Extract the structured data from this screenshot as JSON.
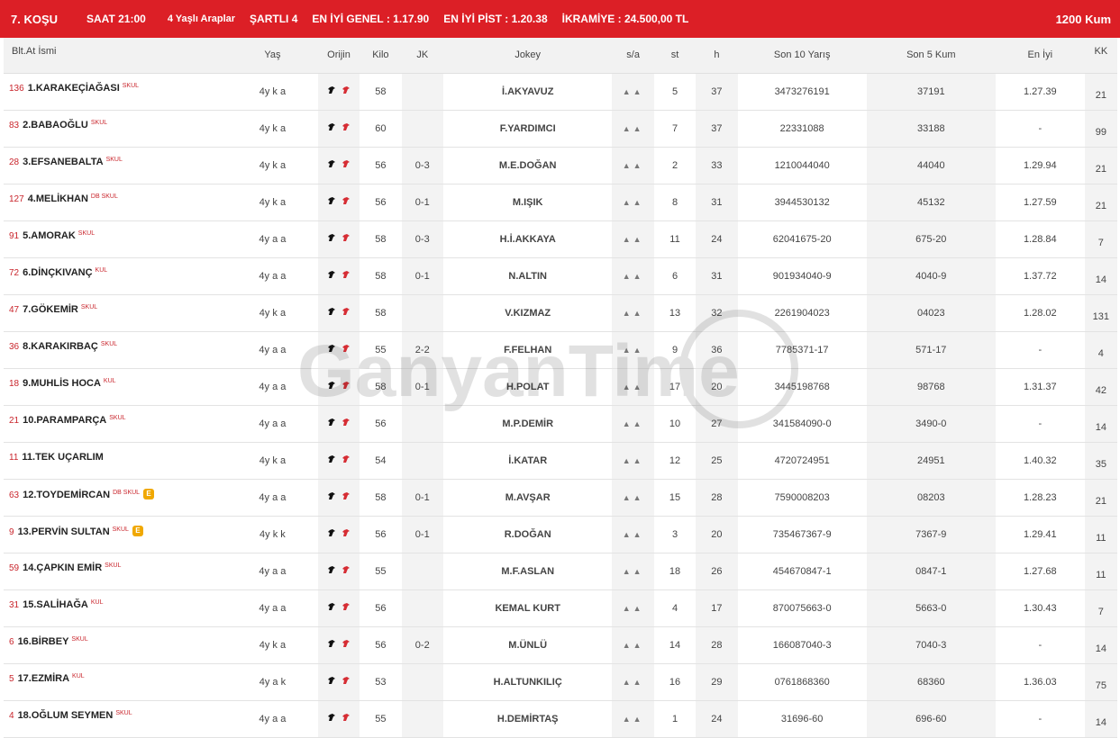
{
  "header": {
    "race": "7. KOŞU",
    "time": "SAAT 21:00",
    "class": "4 Yaşlı Araplar",
    "condition": "ŞARTLI 4",
    "best_overall": "EN İYİ GENEL : 1.17.90",
    "best_track": "EN İYİ PİST : 1.20.38",
    "prize": "İKRAMİYE : 24.500,00 TL",
    "distance": "1200 Kum"
  },
  "columns": {
    "name": "Blt.At İsmi",
    "age": "Yaş",
    "origin": "Orijin",
    "weight": "Kilo",
    "jk": "JK",
    "jockey": "Jokey",
    "sa": "s/a",
    "st": "st",
    "h": "h",
    "last10": "Son 10 Yarış",
    "last5": "Son 5 Kum",
    "best": "En İyi",
    "kk": "KK"
  },
  "watermark": "GanyanTime",
  "colors": {
    "accent": "#dc1f26",
    "equipment": "#c9252c",
    "badge": "#f0a800"
  },
  "rows": [
    {
      "blt": "136",
      "name": "1.KARAKEÇİAĞASI",
      "eq": "SKUL",
      "badge": "",
      "age": "4y k a",
      "weight": "58",
      "jk": "",
      "jockey": "İ.AKYAVUZ",
      "st": "5",
      "h": "37",
      "last10": "3473276191",
      "last5": "37191",
      "best": "1.27.39",
      "kk": "21"
    },
    {
      "blt": "83",
      "name": "2.BABAOĞLU",
      "eq": "SKUL",
      "badge": "",
      "age": "4y k a",
      "weight": "60",
      "jk": "",
      "jockey": "F.YARDIMCI",
      "st": "7",
      "h": "37",
      "last10": "22331088",
      "last5": "33188",
      "best": "-",
      "kk": "99"
    },
    {
      "blt": "28",
      "name": "3.EFSANEBALTA",
      "eq": "SKUL",
      "badge": "",
      "age": "4y k a",
      "weight": "56",
      "jk": "0-3",
      "jockey": "M.E.DOĞAN",
      "st": "2",
      "h": "33",
      "last10": "1210044040",
      "last5": "44040",
      "best": "1.29.94",
      "kk": "21"
    },
    {
      "blt": "127",
      "name": "4.MELİKHAN",
      "eq": "DB SKUL",
      "badge": "",
      "age": "4y k a",
      "weight": "56",
      "jk": "0-1",
      "jockey": "M.IŞIK",
      "st": "8",
      "h": "31",
      "last10": "3944530132",
      "last5": "45132",
      "best": "1.27.59",
      "kk": "21"
    },
    {
      "blt": "91",
      "name": "5.AMORAK",
      "eq": "SKUL",
      "badge": "",
      "age": "4y a a",
      "weight": "58",
      "jk": "0-3",
      "jockey": "H.İ.AKKAYA",
      "st": "11",
      "h": "24",
      "last10": "62041675-20",
      "last5": "675-20",
      "best": "1.28.84",
      "kk": "7"
    },
    {
      "blt": "72",
      "name": "6.DİNÇKIVANÇ",
      "eq": "KUL",
      "badge": "",
      "age": "4y a a",
      "weight": "58",
      "jk": "0-1",
      "jockey": "N.ALTIN",
      "st": "6",
      "h": "31",
      "last10": "901934040-9",
      "last5": "4040-9",
      "best": "1.37.72",
      "kk": "14"
    },
    {
      "blt": "47",
      "name": "7.GÖKEMİR",
      "eq": "SKUL",
      "badge": "",
      "age": "4y k a",
      "weight": "58",
      "jk": "",
      "jockey": "V.KIZMAZ",
      "st": "13",
      "h": "32",
      "last10": "2261904023",
      "last5": "04023",
      "best": "1.28.02",
      "kk": "131"
    },
    {
      "blt": "36",
      "name": "8.KARAKIRBAÇ",
      "eq": "SKUL",
      "badge": "",
      "age": "4y a a",
      "weight": "55",
      "jk": "2-2",
      "jockey": "F.FELHAN",
      "st": "9",
      "h": "36",
      "last10": "7785371-17",
      "last5": "571-17",
      "best": "-",
      "kk": "4"
    },
    {
      "blt": "18",
      "name": "9.MUHLİS HOCA",
      "eq": "KUL",
      "badge": "",
      "age": "4y a a",
      "weight": "58",
      "jk": "0-1",
      "jockey": "H.POLAT",
      "st": "17",
      "h": "20",
      "last10": "3445198768",
      "last5": "98768",
      "best": "1.31.37",
      "kk": "42"
    },
    {
      "blt": "21",
      "name": "10.PARAMPARÇA",
      "eq": "SKUL",
      "badge": "",
      "age": "4y a a",
      "weight": "56",
      "jk": "",
      "jockey": "M.P.DEMİR",
      "st": "10",
      "h": "27",
      "last10": "341584090-0",
      "last5": "3490-0",
      "best": "-",
      "kk": "14"
    },
    {
      "blt": "11",
      "name": "11.TEK UÇARLIM",
      "eq": "",
      "badge": "",
      "age": "4y k a",
      "weight": "54",
      "jk": "",
      "jockey": "İ.KATAR",
      "st": "12",
      "h": "25",
      "last10": "4720724951",
      "last5": "24951",
      "best": "1.40.32",
      "kk": "35"
    },
    {
      "blt": "63",
      "name": "12.TOYDEMİRCAN",
      "eq": "DB SKUL",
      "badge": "E",
      "age": "4y a a",
      "weight": "58",
      "jk": "0-1",
      "jockey": "M.AVŞAR",
      "st": "15",
      "h": "28",
      "last10": "7590008203",
      "last5": "08203",
      "best": "1.28.23",
      "kk": "21"
    },
    {
      "blt": "9",
      "name": "13.PERVİN SULTAN",
      "eq": "SKUL",
      "badge": "E",
      "age": "4y k k",
      "weight": "56",
      "jk": "0-1",
      "jockey": "R.DOĞAN",
      "st": "3",
      "h": "20",
      "last10": "735467367-9",
      "last5": "7367-9",
      "best": "1.29.41",
      "kk": "11"
    },
    {
      "blt": "59",
      "name": "14.ÇAPKIN EMİR",
      "eq": "SKUL",
      "badge": "",
      "age": "4y a a",
      "weight": "55",
      "jk": "",
      "jockey": "M.F.ASLAN",
      "st": "18",
      "h": "26",
      "last10": "454670847-1",
      "last5": "0847-1",
      "best": "1.27.68",
      "kk": "11"
    },
    {
      "blt": "31",
      "name": "15.SALİHAĞA",
      "eq": "KUL",
      "badge": "",
      "age": "4y a a",
      "weight": "56",
      "jk": "",
      "jockey": "KEMAL KURT",
      "st": "4",
      "h": "17",
      "last10": "870075663-0",
      "last5": "5663-0",
      "best": "1.30.43",
      "kk": "7"
    },
    {
      "blt": "6",
      "name": "16.BİRBEY",
      "eq": "SKUL",
      "badge": "",
      "age": "4y k a",
      "weight": "56",
      "jk": "0-2",
      "jockey": "M.ÜNLÜ",
      "st": "14",
      "h": "28",
      "last10": "166087040-3",
      "last5": "7040-3",
      "best": "-",
      "kk": "14"
    },
    {
      "blt": "5",
      "name": "17.EZMİRA",
      "eq": "KUL",
      "badge": "",
      "age": "4y a k",
      "weight": "53",
      "jk": "",
      "jockey": "H.ALTUNKILIÇ",
      "st": "16",
      "h": "29",
      "last10": "0761868360",
      "last5": "68360",
      "best": "1.36.03",
      "kk": "75"
    },
    {
      "blt": "4",
      "name": "18.OĞLUM SEYMEN",
      "eq": "SKUL",
      "badge": "",
      "age": "4y a a",
      "weight": "55",
      "jk": "",
      "jockey": "H.DEMİRTAŞ",
      "st": "1",
      "h": "24",
      "last10": "31696-60",
      "last5": "696-60",
      "best": "-",
      "kk": "14"
    }
  ]
}
